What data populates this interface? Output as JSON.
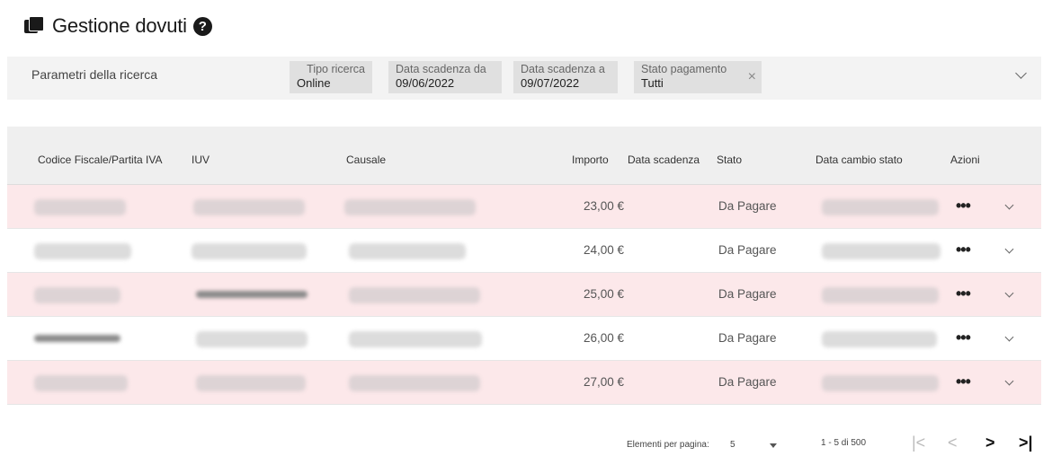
{
  "header": {
    "title": "Gestione dovuti",
    "title_icon": "stacked-squares-icon",
    "help_icon": "question-circle-icon"
  },
  "search": {
    "label": "Parametri della ricerca",
    "chips": [
      {
        "key": "Tipo ricerca",
        "value": "Online"
      },
      {
        "key": "Data scadenza da",
        "value": "09/06/2022"
      },
      {
        "key": "Data scadenza a",
        "value": "09/07/2022"
      },
      {
        "key": "Stato pagamento",
        "value": "Tutti"
      }
    ],
    "chip_close": "×"
  },
  "table": {
    "columns": {
      "cf": "Codice Fiscale/Partita IVA",
      "iuv": "IUV",
      "causale": "Causale",
      "importo": "Importo",
      "data_scadenza": "Data scadenza",
      "stato": "Stato",
      "data_cambio": "Data cambio stato",
      "azioni": "Azioni"
    },
    "rows": [
      {
        "importo": "23,00 €",
        "stato": "Da Pagare",
        "actions": "•••"
      },
      {
        "importo": "24,00 €",
        "stato": "Da Pagare",
        "actions": "•••"
      },
      {
        "importo": "25,00 €",
        "stato": "Da Pagare",
        "actions": "•••"
      },
      {
        "importo": "26,00 €",
        "stato": "Da Pagare",
        "actions": "•••"
      },
      {
        "importo": "27,00 €",
        "stato": "Da Pagare",
        "actions": "•••"
      }
    ]
  },
  "pagination": {
    "per_page_label": "Elementi per pagina:",
    "per_page_value": "5",
    "range": "1 - 5 di 500",
    "first": "|<",
    "prev": "<",
    "next": ">",
    "last": ">|"
  },
  "colors": {
    "row_highlight": "#fce8ea",
    "header_bg": "#efefef",
    "search_bg": "#f3f3f3",
    "chip_bg": "#e0e0e0"
  }
}
